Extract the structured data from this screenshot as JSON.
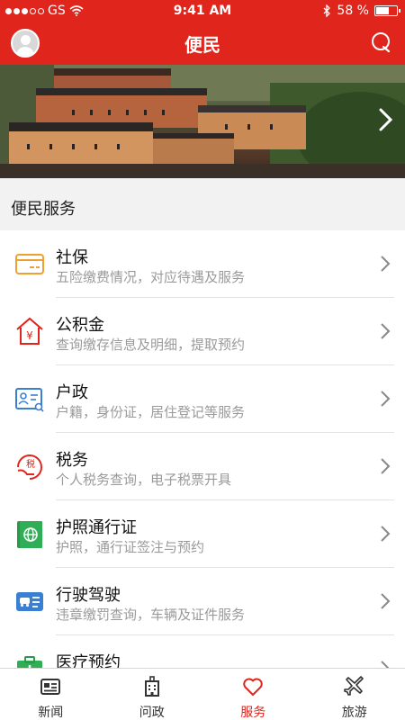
{
  "status": {
    "carrier": "GS",
    "time": "9:41 AM",
    "battery_text": "58 %",
    "battery_level": 0.58
  },
  "header": {
    "title": "便民"
  },
  "section": {
    "title": "便民服务"
  },
  "services": [
    {
      "title": "社保",
      "subtitle": "五险缴费情况，对应待遇及服务",
      "icon": "card-icon",
      "color": "#f0a030"
    },
    {
      "title": "公积金",
      "subtitle": "查询缴存信息及明细，提取预约",
      "icon": "house-yuan-icon",
      "color": "#e0251c"
    },
    {
      "title": "户政",
      "subtitle": "户籍，身份证，居住登记等服务",
      "icon": "id-card-icon",
      "color": "#3b7fd0"
    },
    {
      "title": "税务",
      "subtitle": "个人税务查询，电子税票开具",
      "icon": "tax-icon",
      "color": "#e0251c"
    },
    {
      "title": "护照通行证",
      "subtitle": "护照，通行证签注与预约",
      "icon": "passport-icon",
      "color": "#2a9a4a"
    },
    {
      "title": "行驶驾驶",
      "subtitle": "违章缴罚查询，车辆及证件服务",
      "icon": "car-license-icon",
      "color": "#3b7fd0"
    },
    {
      "title": "医疗预约",
      "subtitle": "",
      "icon": "medical-kit-icon",
      "color": "#2a9a4a"
    }
  ],
  "tabs": [
    {
      "label": "新闻",
      "icon": "news-icon",
      "active": false
    },
    {
      "label": "问政",
      "icon": "building-icon",
      "active": false
    },
    {
      "label": "服务",
      "icon": "heart-icon",
      "active": true
    },
    {
      "label": "旅游",
      "icon": "plane-icon",
      "active": false
    }
  ],
  "colors": {
    "brand_red": "#e0251c",
    "subtitle_gray": "#9a9a9a"
  }
}
